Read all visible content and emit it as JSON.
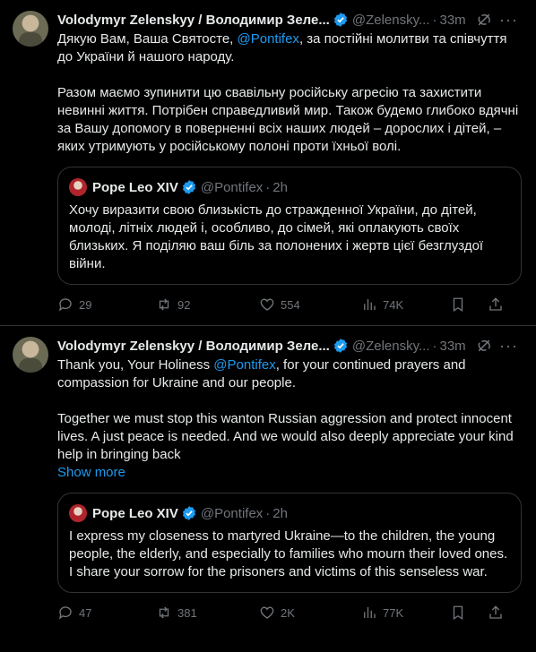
{
  "tweets": [
    {
      "author_name": "Volodymyr Zelenskyy / Володимир Зеле...",
      "handle": "@Zelensky...",
      "separator": "·",
      "time": "33m",
      "text_before": "Дякую Вам, Ваша Святосте, ",
      "mention": "@Pontifex",
      "text_after": ", за постійні молитви та співчуття до України й нашого народу.\n\nРазом маємо зупинити цю свавільну російську агресію та захистити невинні життя. Потрібен справедливий мир. Також будемо глибоко вдячні за Вашу допомогу в поверненні всіх наших людей – дорослих і дітей, – яких утримують у російському полоні проти їхньої волі.",
      "show_more": "",
      "quote": {
        "author_name": "Pope Leo XIV",
        "handle": "@Pontifex",
        "separator": "·",
        "time": "2h",
        "text": "Хочу виразити свою близькість до стражденної України, до дітей, молоді, літніх людей і, особливо, до сімей, які оплакують своїх близьких. Я поділяю ваш біль за полонених і жертв цієї безглуздої війни."
      },
      "replies": "29",
      "reposts": "92",
      "likes": "554",
      "views": "74K"
    },
    {
      "author_name": "Volodymyr Zelenskyy / Володимир Зеле...",
      "handle": "@Zelensky...",
      "separator": "·",
      "time": "33m",
      "text_before": "Thank you, Your Holiness ",
      "mention": "@Pontifex",
      "text_after": ", for your continued prayers and compassion for Ukraine and our people.\n\nTogether we must stop this wanton Russian aggression and protect innocent lives. A just peace is needed. And we would also deeply appreciate your kind help in bringing back",
      "show_more": "Show more",
      "quote": {
        "author_name": "Pope Leo XIV",
        "handle": "@Pontifex",
        "separator": "·",
        "time": "2h",
        "text": "I express my closeness to martyred Ukraine—to the children, the young people, the elderly, and especially to families who mourn their loved ones. I share your sorrow for the prisoners and victims of this senseless war."
      },
      "replies": "47",
      "reposts": "381",
      "likes": "2K",
      "views": "77K"
    }
  ],
  "icons": {
    "verified": "verified-badge-icon",
    "grok": "grok-icon",
    "more": "more-options-icon",
    "reply": "reply-icon",
    "repost": "repost-icon",
    "like": "like-icon",
    "views": "views-icon",
    "bookmark": "bookmark-icon",
    "share": "share-icon"
  },
  "colors": {
    "accent": "#1d9bf0",
    "muted": "#71767b",
    "text": "#e7e9ea",
    "border": "#2f3336"
  }
}
